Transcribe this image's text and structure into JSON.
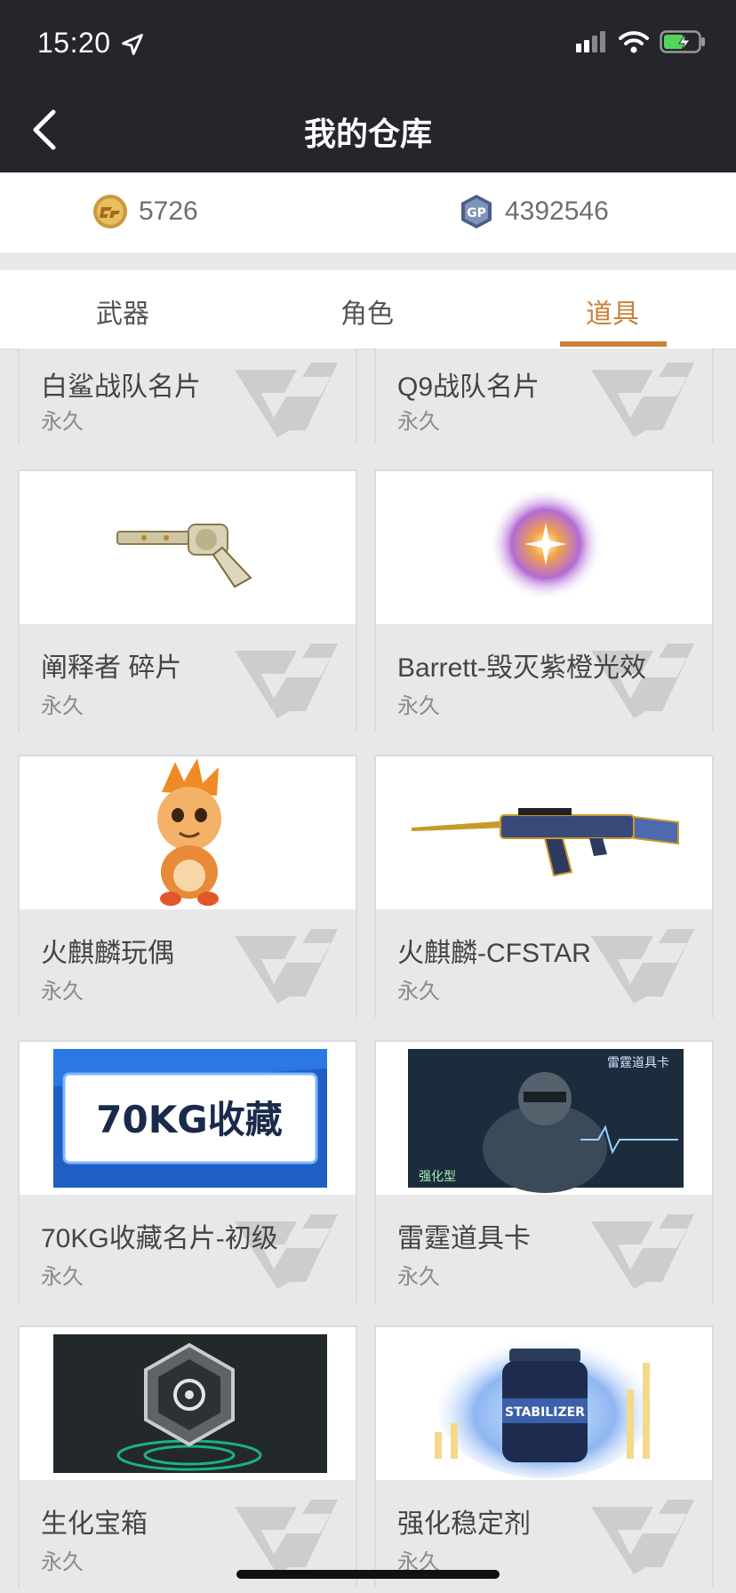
{
  "status": {
    "time": "15:20"
  },
  "nav": {
    "title": "我的仓库"
  },
  "currency": {
    "cf_points": "5726",
    "gp": "4392546"
  },
  "tabs": [
    {
      "label": "武器",
      "active": false
    },
    {
      "label": "角色",
      "active": false
    },
    {
      "label": "道具",
      "active": true
    }
  ],
  "colors": {
    "accent": "#c9813a",
    "header": "#25262b",
    "card_info_bg": "#e8e8e8"
  },
  "items": [
    {
      "name": "白鲨战队名片",
      "duration": "永久"
    },
    {
      "name": "Q9战队名片",
      "duration": "永久"
    },
    {
      "name": "阐释者 碎片",
      "duration": "永久",
      "image": "revolver-icon"
    },
    {
      "name": "Barrett-毁灭紫橙光效",
      "duration": "永久",
      "image": "glow-effect-icon"
    },
    {
      "name": "火麒麟玩偶",
      "duration": "永久",
      "image": "doll-icon"
    },
    {
      "name": "火麒麟-CFSTAR",
      "duration": "永久",
      "image": "rifle-icon"
    },
    {
      "name": "70KG收藏名片-初级",
      "duration": "永久",
      "image": "card-banner",
      "banner_text": "70KG收藏"
    },
    {
      "name": "雷霆道具卡",
      "duration": "永久",
      "image": "soldier-card",
      "banner_tag": "雷霆道具卡",
      "banner_sub": "强化型"
    },
    {
      "name": "生化宝箱",
      "duration": "永久",
      "image": "biohazard-box-icon"
    },
    {
      "name": "强化稳定剂",
      "duration": "永久",
      "image": "stabilizer-icon",
      "label_text": "STABILIZER"
    }
  ]
}
